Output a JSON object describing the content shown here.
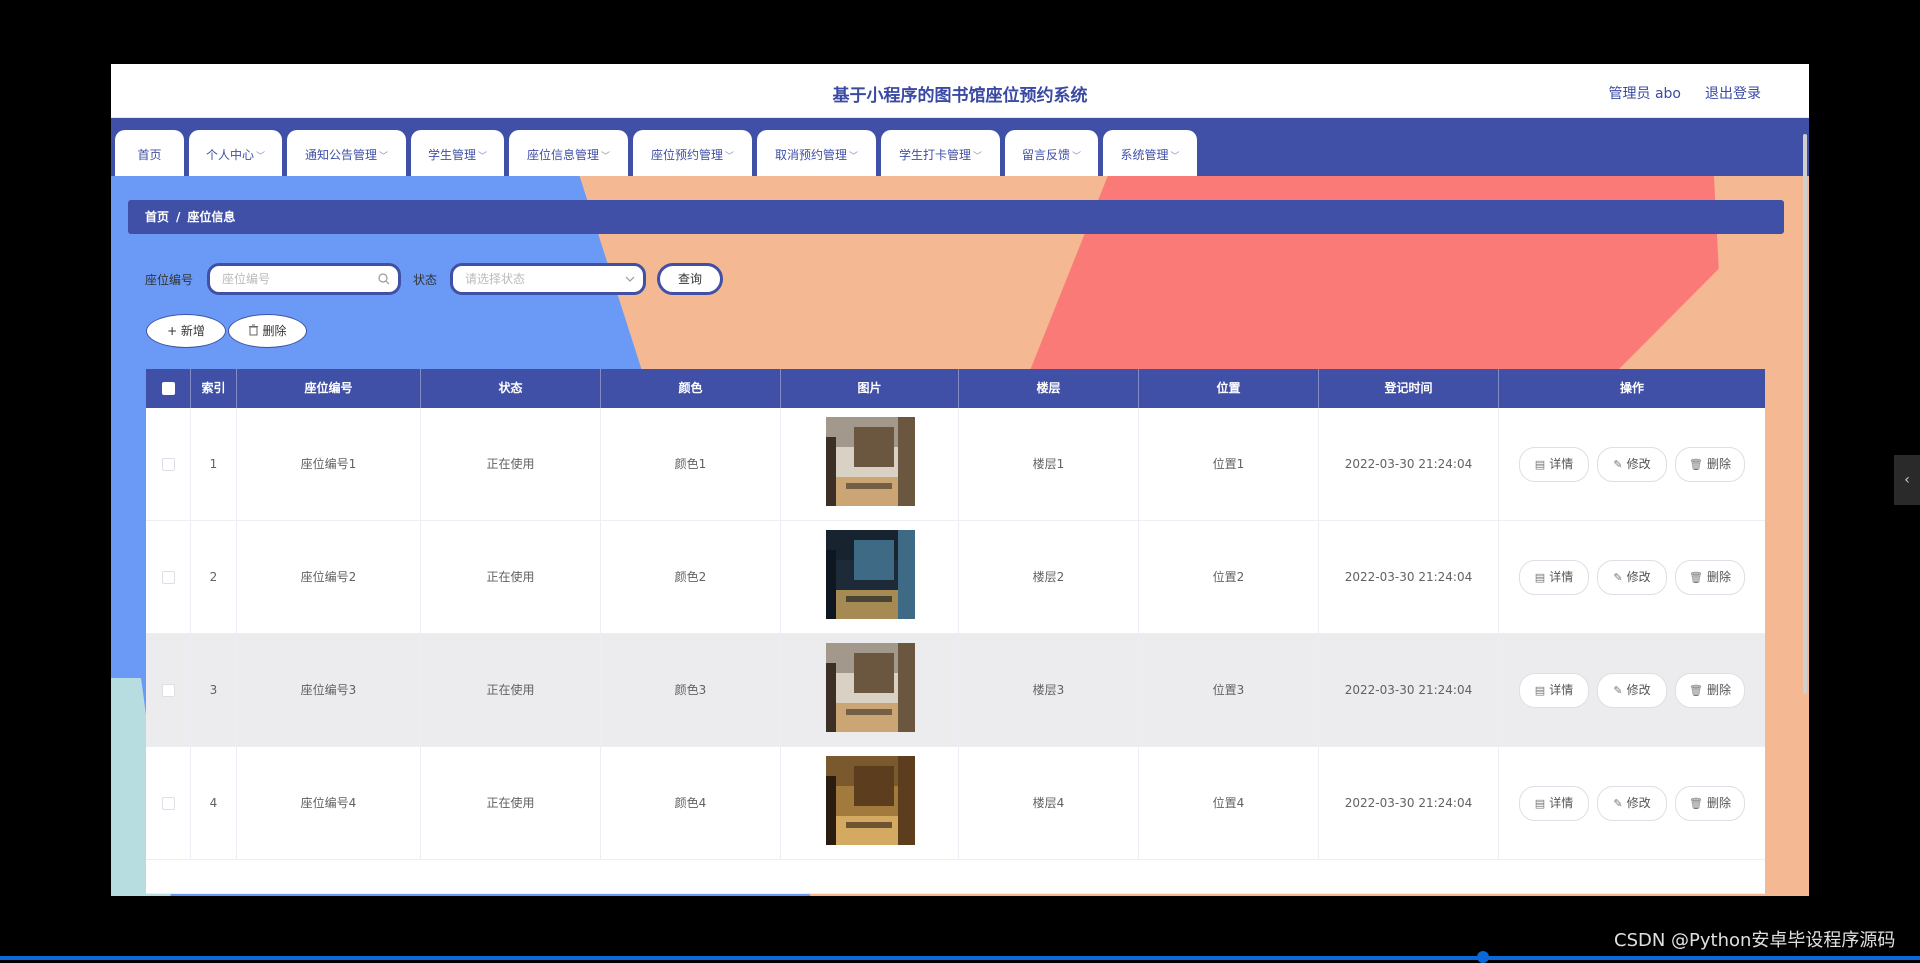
{
  "header": {
    "title": "基于小程序的图书馆座位预约系统",
    "admin_label": "管理员 abo",
    "logout_label": "退出登录"
  },
  "nav": {
    "items": [
      {
        "label": "首页",
        "has_dropdown": false
      },
      {
        "label": "个人中心",
        "has_dropdown": true
      },
      {
        "label": "通知公告管理",
        "has_dropdown": true
      },
      {
        "label": "学生管理",
        "has_dropdown": true
      },
      {
        "label": "座位信息管理",
        "has_dropdown": true
      },
      {
        "label": "座位预约管理",
        "has_dropdown": true
      },
      {
        "label": "取消预约管理",
        "has_dropdown": true
      },
      {
        "label": "学生打卡管理",
        "has_dropdown": true
      },
      {
        "label": "留言反馈",
        "has_dropdown": true
      },
      {
        "label": "系统管理",
        "has_dropdown": true
      }
    ],
    "chevron_glyph": "﹀"
  },
  "breadcrumb": {
    "home": "首页",
    "separator": "/",
    "current": "座位信息"
  },
  "search": {
    "seat_label": "座位编号",
    "seat_placeholder": "座位编号",
    "status_label": "状态",
    "status_placeholder": "请选择状态",
    "query_label": "查询"
  },
  "actions": {
    "add_label": "+ 新增",
    "delete_label": "删除"
  },
  "table": {
    "columns": [
      "索引",
      "座位编号",
      "状态",
      "颜色",
      "图片",
      "楼层",
      "位置",
      "登记时间",
      "操作"
    ],
    "rows": [
      {
        "index": "1",
        "seat_no": "座位编号1",
        "status": "正在使用",
        "color": "颜色1",
        "floor": "楼层1",
        "position": "位置1",
        "time": "2022-03-30 21:24:04",
        "image": "library-photo-warm"
      },
      {
        "index": "2",
        "seat_no": "座位编号2",
        "status": "正在使用",
        "color": "颜色2",
        "floor": "楼层2",
        "position": "位置2",
        "time": "2022-03-30 21:24:04",
        "image": "library-photo-hall"
      },
      {
        "index": "3",
        "seat_no": "座位编号3",
        "status": "正在使用",
        "color": "颜色3",
        "floor": "楼层3",
        "position": "位置3",
        "time": "2022-03-30 21:24:04",
        "image": "library-photo-warm"
      },
      {
        "index": "4",
        "seat_no": "座位编号4",
        "status": "正在使用",
        "color": "颜色4",
        "floor": "楼层4",
        "position": "位置4",
        "time": "2022-03-30 21:24:04",
        "image": "library-photo-shelves"
      }
    ],
    "op_detail": "详情",
    "op_edit": "修改",
    "op_delete": "删除"
  },
  "overlay": {
    "watermark": "CSDN @Python安卓毕设程序源码",
    "side_tab_glyph": "‹"
  },
  "colors": {
    "primary": "#4050a6",
    "bg_blue": "#6a9af5",
    "bg_peach": "#f4b993",
    "bg_coral": "#fa7a78",
    "bg_teal": "#b7dde0"
  }
}
